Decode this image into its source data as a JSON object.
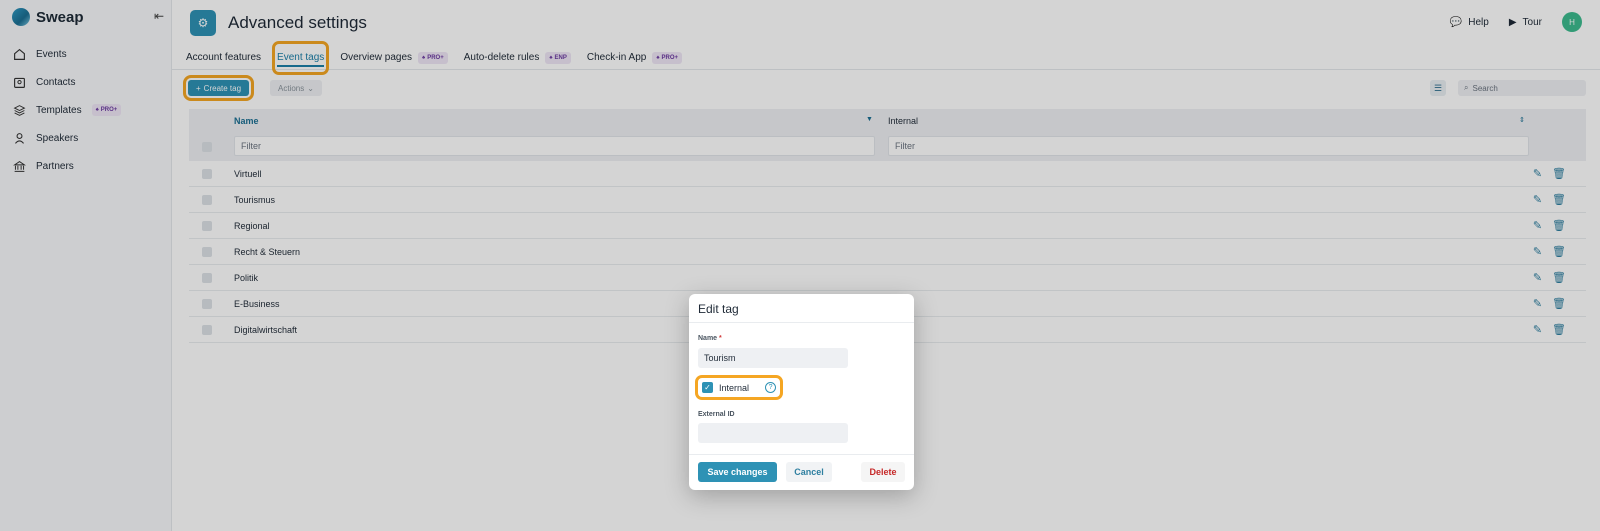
{
  "app": {
    "name": "Sweap"
  },
  "sidebar": {
    "items": [
      {
        "label": "Events",
        "icon": "home-icon"
      },
      {
        "label": "Contacts",
        "icon": "contacts-icon"
      },
      {
        "label": "Templates",
        "icon": "layers-icon",
        "badge": "PRO+"
      },
      {
        "label": "Speakers",
        "icon": "speaker-icon"
      },
      {
        "label": "Partners",
        "icon": "bank-icon"
      }
    ]
  },
  "header": {
    "title": "Advanced settings",
    "help_label": "Help",
    "tour_label": "Tour",
    "avatar_initial": "H"
  },
  "tabs": [
    {
      "label": "Account features"
    },
    {
      "label": "Event tags",
      "active": true
    },
    {
      "label": "Overview pages",
      "badge": "PRO+"
    },
    {
      "label": "Auto-delete rules",
      "badge": "ENP"
    },
    {
      "label": "Check-in App",
      "badge": "PRO+"
    }
  ],
  "toolbar": {
    "create_label": "Create tag",
    "actions_label": "Actions",
    "search_placeholder": "Search"
  },
  "table": {
    "columns": {
      "name": "Name",
      "internal": "Internal"
    },
    "filter_placeholder": "Filter",
    "rows": [
      "Virtuell",
      "Tourismus",
      "Regional",
      "Recht & Steuern",
      "Politik",
      "E-Business",
      "Digitalwirtschaft"
    ]
  },
  "modal": {
    "title": "Edit tag",
    "name_label": "Name",
    "name_required": "*",
    "name_value": "Tourism",
    "internal_label": "Internal",
    "internal_checked": true,
    "external_id_label": "External ID",
    "external_id_value": "",
    "save_label": "Save changes",
    "cancel_label": "Cancel",
    "delete_label": "Delete"
  },
  "colors": {
    "accent": "#2e92b5",
    "highlight": "#f5a623",
    "delete": "#c62828"
  }
}
